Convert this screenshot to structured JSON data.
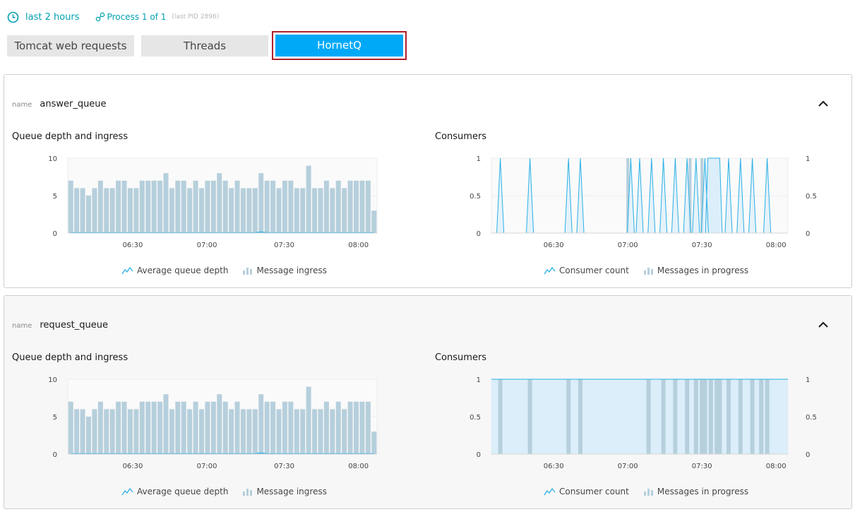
{
  "topbar": {
    "timeframe": "last 2 hours",
    "process": "Process 1 of 1",
    "lastpid": "(last PID 2896)"
  },
  "tabs": [
    {
      "label": "Tomcat web requests",
      "active": false
    },
    {
      "label": "Threads",
      "active": false
    },
    {
      "label": "HornetQ",
      "active": true
    }
  ],
  "colors": {
    "accent": "#00a1b2",
    "active_tab": "#00a9f8",
    "bar": "#b6cfdc",
    "line": "#2ab0e6",
    "area": "#dbeef9"
  },
  "queues": [
    {
      "name_key": "name",
      "name": "answer_queue",
      "left_title": "Queue depth and ingress",
      "right_title": "Consumers",
      "left_legend": [
        "Average queue depth",
        "Message ingress"
      ],
      "right_legend": [
        "Consumer count",
        "Messages in progress"
      ]
    },
    {
      "name_key": "name",
      "name": "request_queue",
      "left_title": "Queue depth and ingress",
      "right_title": "Consumers",
      "left_legend": [
        "Average queue depth",
        "Message ingress"
      ],
      "right_legend": [
        "Consumer count",
        "Messages in progress"
      ]
    }
  ],
  "chart_data": [
    {
      "type": "bar",
      "title": "Queue depth and ingress",
      "ylim": [
        0,
        10
      ],
      "yticks": [
        "0",
        "5",
        "10"
      ],
      "xticks": [
        "06:30",
        "07:00",
        "07:30",
        "08:00"
      ],
      "series": [
        {
          "name": "Message ingress",
          "values": [
            7,
            6,
            6,
            5,
            6,
            7,
            6,
            6,
            7,
            7,
            6,
            6,
            7,
            7,
            7,
            7,
            8,
            6,
            7,
            7,
            6,
            7,
            6,
            7,
            7,
            8,
            7,
            6,
            7,
            6,
            6,
            6,
            8,
            7,
            7,
            6,
            7,
            7,
            6,
            6,
            9,
            6,
            6,
            7,
            6,
            7,
            6,
            7,
            7,
            7,
            7,
            3
          ]
        },
        {
          "name": "Average queue depth",
          "values": [
            0,
            0,
            0,
            0,
            0,
            0,
            0,
            0,
            0,
            0,
            0,
            0,
            0,
            0,
            0,
            0,
            0,
            0,
            0,
            0,
            0,
            0,
            0,
            0,
            0,
            0,
            0,
            0,
            0,
            0,
            0,
            0,
            0.1,
            0,
            0,
            0,
            0,
            0,
            0,
            0,
            0,
            0,
            0,
            0,
            0,
            0,
            0,
            0,
            0,
            0,
            0,
            0
          ]
        }
      ]
    },
    {
      "type": "line",
      "title": "Consumers",
      "ylim": [
        0,
        1
      ],
      "yticks": [
        "0",
        "0.5",
        "1"
      ],
      "xticks": [
        "06:30",
        "07:00",
        "07:30",
        "08:00"
      ],
      "series": [
        {
          "name": "Consumer count",
          "spikes": [
            0.03,
            0.13,
            0.26,
            0.3,
            0.47,
            0.5,
            0.54,
            0.58,
            0.62,
            0.66,
            0.69,
            0.72,
            0.8,
            0.84,
            0.88,
            0.93
          ],
          "plateau": [
            0.73,
            0.77
          ]
        },
        {
          "name": "Messages in progress",
          "bars": [
            0.46,
            0.67,
            0.71
          ]
        }
      ]
    },
    {
      "type": "bar",
      "title": "Queue depth and ingress",
      "ylim": [
        0,
        10
      ],
      "yticks": [
        "0",
        "5",
        "10"
      ],
      "xticks": [
        "06:30",
        "07:00",
        "07:30",
        "08:00"
      ],
      "series": [
        {
          "name": "Message ingress",
          "values": [
            7,
            6,
            6,
            5,
            6,
            7,
            6,
            6,
            7,
            7,
            6,
            6,
            7,
            7,
            7,
            7,
            8,
            6,
            7,
            7,
            6,
            7,
            6,
            7,
            7,
            8,
            7,
            6,
            7,
            6,
            6,
            6,
            8,
            7,
            7,
            6,
            7,
            7,
            6,
            6,
            9,
            6,
            6,
            7,
            6,
            7,
            6,
            7,
            7,
            7,
            7,
            3
          ]
        },
        {
          "name": "Average queue depth",
          "values": [
            0,
            0,
            0,
            0,
            0,
            0,
            0,
            0,
            0,
            0,
            0,
            0,
            0,
            0,
            0,
            0,
            0,
            0,
            0,
            0,
            0,
            0,
            0,
            0,
            0,
            0,
            0,
            0,
            0,
            0,
            0,
            0,
            0.1,
            0,
            0,
            0,
            0,
            0,
            0,
            0,
            0,
            0,
            0,
            0,
            0,
            0,
            0,
            0,
            0,
            0,
            0,
            0
          ]
        }
      ]
    },
    {
      "type": "area",
      "title": "Consumers",
      "ylim": [
        0,
        1
      ],
      "yticks": [
        "0",
        "0.5",
        "1"
      ],
      "xticks": [
        "06:30",
        "07:00",
        "07:30",
        "08:00"
      ],
      "series": [
        {
          "name": "Consumer count",
          "value": 1
        },
        {
          "name": "Messages in progress",
          "bars": [
            0.03,
            0.13,
            0.26,
            0.3,
            0.53,
            0.58,
            0.62,
            0.66,
            0.69,
            0.71,
            0.72,
            0.74,
            0.76,
            0.77,
            0.8,
            0.84,
            0.88,
            0.91,
            0.93
          ]
        }
      ]
    }
  ]
}
